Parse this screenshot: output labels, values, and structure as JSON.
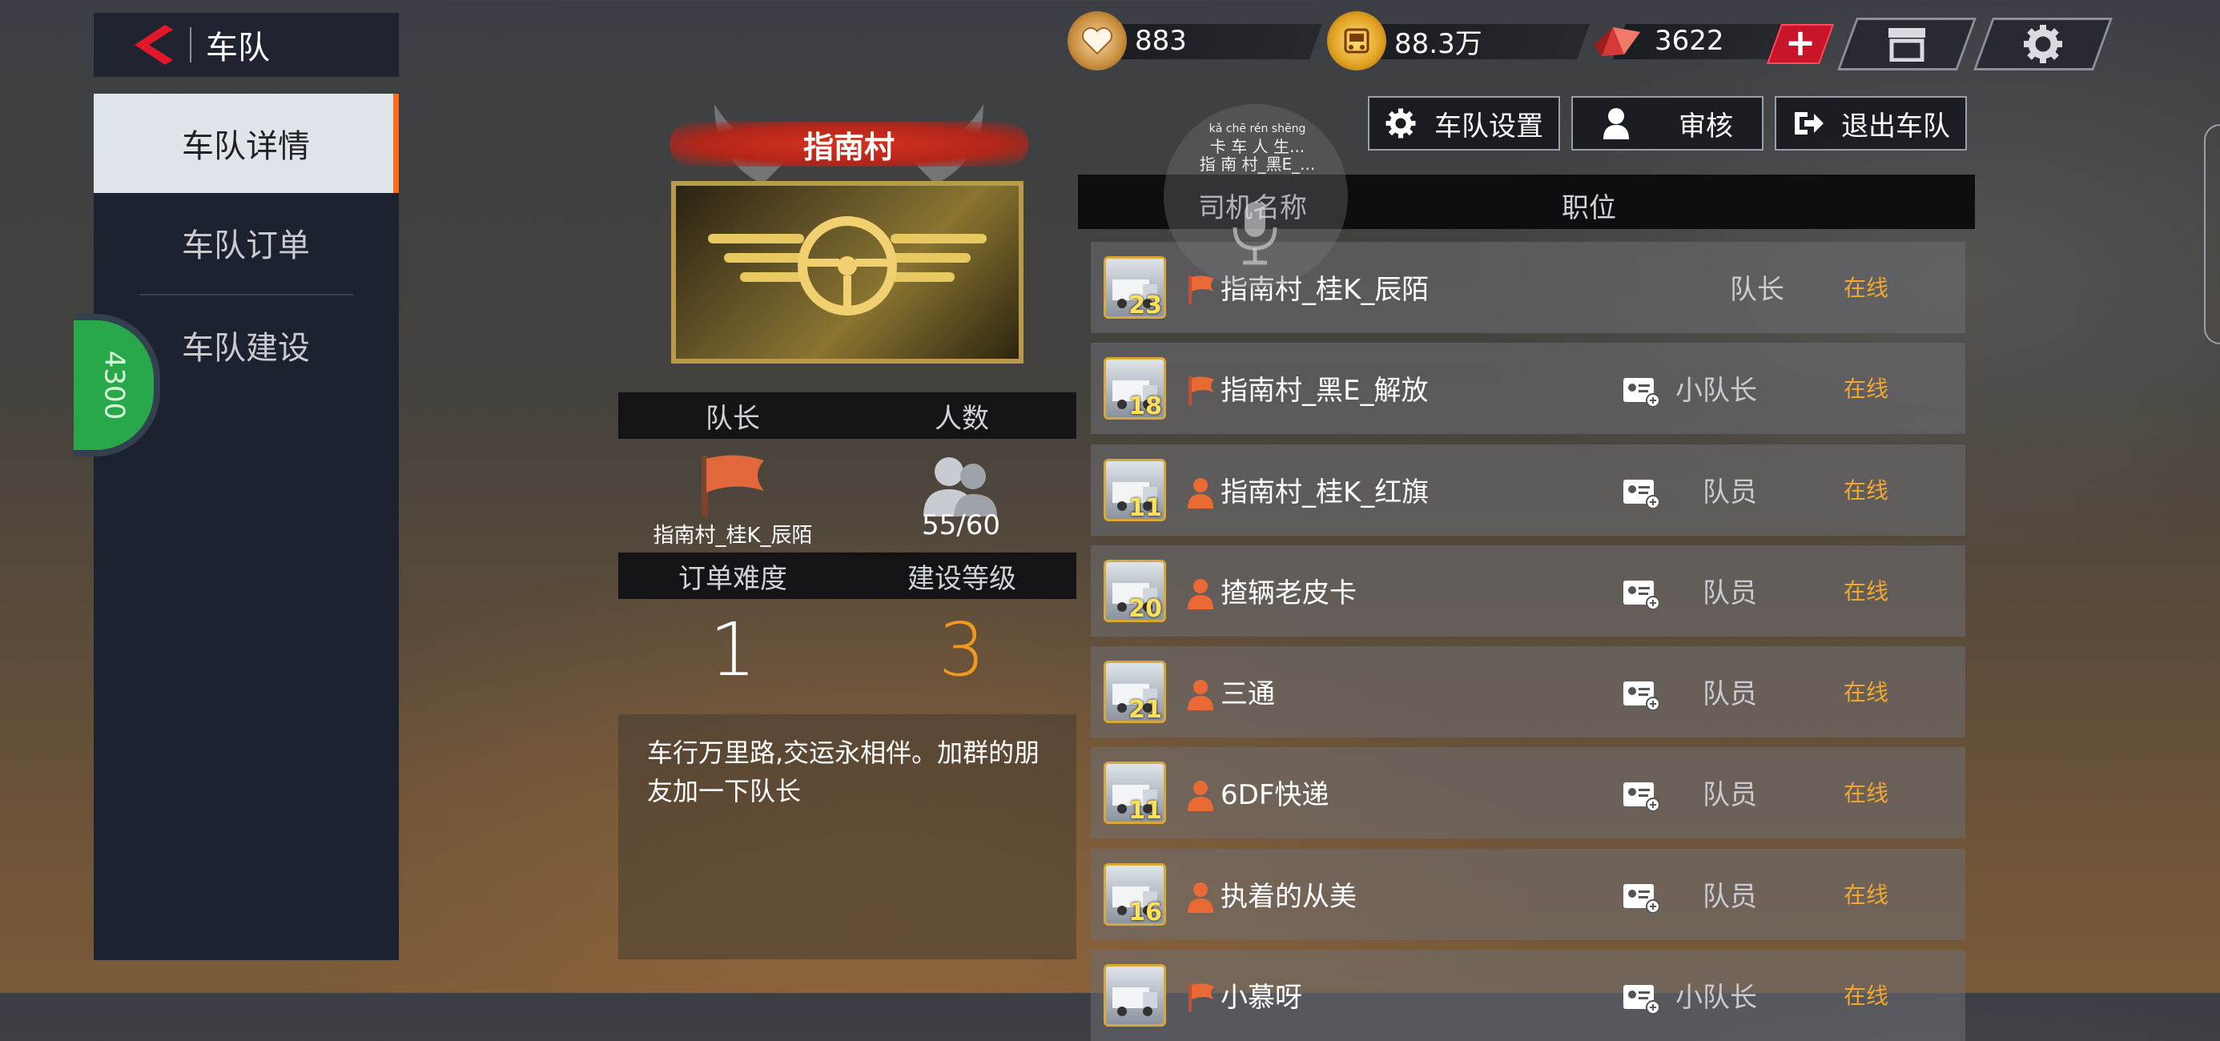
{
  "header": {
    "back_title": "车队",
    "currencies": [
      {
        "name": "hearts",
        "value": "883"
      },
      {
        "name": "gold",
        "value": "88.3万"
      },
      {
        "name": "gems",
        "value": "3622"
      }
    ],
    "plus_label": "+"
  },
  "sidebar": {
    "items": [
      {
        "label": "车队详情",
        "active": true
      },
      {
        "label": "车队订单",
        "active": false
      },
      {
        "label": "车队建设",
        "active": false
      }
    ],
    "badge_text": "4300"
  },
  "team": {
    "name": "指南村",
    "leader_header": "队长",
    "members_header": "人数",
    "leader_name": "指南村_桂K_辰陌",
    "member_count": "55/60",
    "difficulty_header": "订单难度",
    "level_header": "建设等级",
    "difficulty": "1",
    "level": "3",
    "description": "车行万里路,交运永相伴。加群的朋友加一下队长"
  },
  "actions": {
    "settings": "车队设置",
    "review": "审核",
    "quit": "退出车队"
  },
  "list": {
    "col_driver": "司机名称",
    "col_role": "职位",
    "members": [
      {
        "name": "指南村_桂K_辰陌",
        "role": "队长",
        "status": "在线",
        "level": "23",
        "rank": "flag",
        "card": false
      },
      {
        "name": "指南村_黑E_解放",
        "role": "小队长",
        "status": "在线",
        "level": "18",
        "rank": "flag",
        "card": true
      },
      {
        "name": "指南村_桂K_红旗",
        "role": "队员",
        "status": "在线",
        "level": "11",
        "rank": "person",
        "card": true
      },
      {
        "name": "揸辆老皮卡",
        "role": "队员",
        "status": "在线",
        "level": "20",
        "rank": "person",
        "card": true
      },
      {
        "name": "三通",
        "role": "队员",
        "status": "在线",
        "level": "21",
        "rank": "person",
        "card": true
      },
      {
        "name": "6DF快递",
        "role": "队员",
        "status": "在线",
        "level": "11",
        "rank": "person",
        "card": true
      },
      {
        "name": "执着的从美",
        "role": "队员",
        "status": "在线",
        "level": "16",
        "rank": "person",
        "card": true
      },
      {
        "name": "小慕呀",
        "role": "小队长",
        "status": "在线",
        "level": "",
        "rank": "flag",
        "card": true
      }
    ]
  },
  "voice": {
    "pinyin": "kǎ chē rén shēng",
    "line1": "卡 车 人 生...",
    "line2": "指 南 村_黑E_..."
  },
  "colors": {
    "accent_orange": "#ff6a1a",
    "status_online": "#f0a830",
    "level_orange": "#f09820",
    "sidebar_bg": "#1d2230"
  }
}
